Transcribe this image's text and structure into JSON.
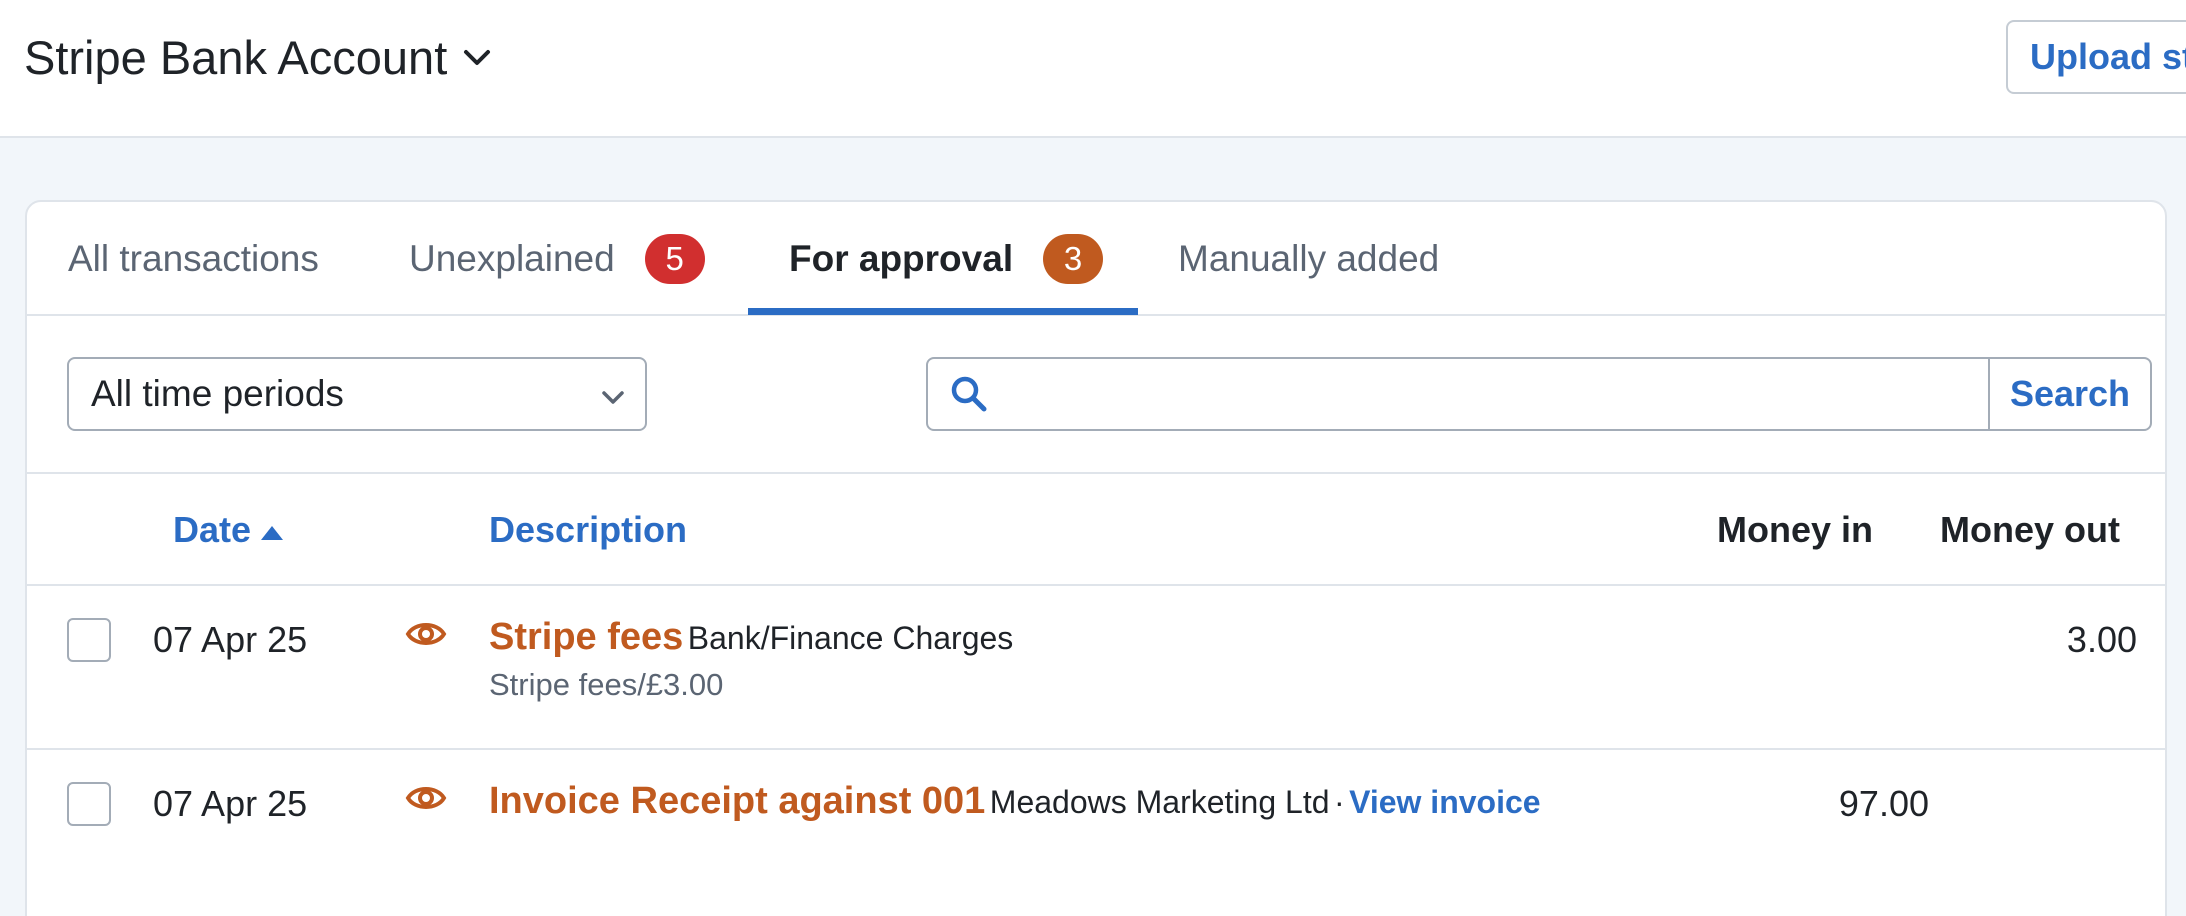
{
  "header": {
    "account_name": "Stripe Bank Account",
    "upload_label": "Upload statement"
  },
  "tabs": [
    {
      "label": "All transactions",
      "active": false
    },
    {
      "label": "Unexplained",
      "badge": "5",
      "badge_color": "#d12f2f",
      "active": false
    },
    {
      "label": "For approval",
      "badge": "3",
      "badge_color": "#c05a1f",
      "active": true
    },
    {
      "label": "Manually added",
      "active": false
    }
  ],
  "filters": {
    "period_selected": "All time periods",
    "search_placeholder": "",
    "search_label": "Search"
  },
  "columns": {
    "date": "Date",
    "description": "Description",
    "money_in": "Money in",
    "money_out": "Money out"
  },
  "rows": [
    {
      "date": "07 Apr 25",
      "title": "Stripe fees",
      "category": "Bank/Finance Charges",
      "subtext": "Stripe fees/£3.00",
      "money_in": "",
      "money_out": "3.00"
    },
    {
      "date": "07 Apr 25",
      "title": "Invoice Receipt against 001",
      "category": "Meadows Marketing Ltd",
      "separator": "·",
      "link": "View invoice",
      "money_in": "97.00",
      "money_out": ""
    }
  ],
  "colors": {
    "accent": "#2b6cc4",
    "warning": "#c05a1f",
    "danger": "#d12f2f"
  }
}
